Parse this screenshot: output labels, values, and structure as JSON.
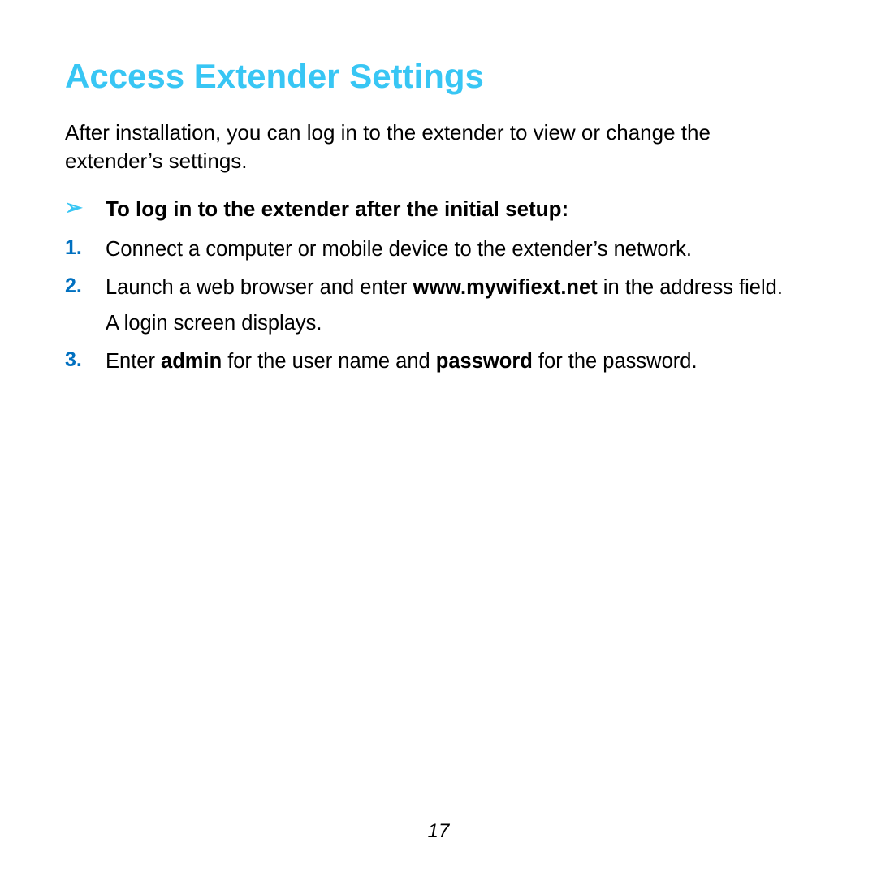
{
  "title": "Access Extender Settings",
  "intro": "After installation, you can log in to the extender to view or change the extender’s settings.",
  "procedure_label": "To log in to the extender after the initial setup:",
  "steps": {
    "s1": {
      "num": "1.",
      "text": "Connect a computer or mobile device to the extender’s network."
    },
    "s2": {
      "num": "2.",
      "pre": "Launch a web browser and enter ",
      "bold": "www.mywifiext.net",
      "post": " in the address field.",
      "follow": "A login screen displays."
    },
    "s3": {
      "num": "3.",
      "p0": "Enter ",
      "b0": "admin",
      "p1": " for the user name and ",
      "b1": "password",
      "p2": " for the password."
    }
  },
  "page_number": "17",
  "arrow_glyph": "➢"
}
